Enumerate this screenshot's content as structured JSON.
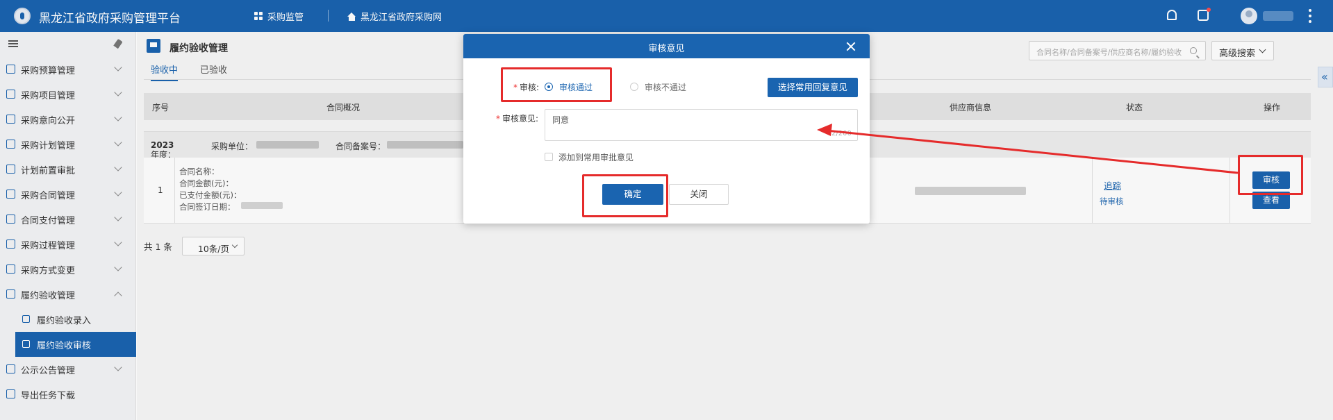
{
  "header": {
    "title": "黑龙江省政府采购管理平台",
    "nav": [
      {
        "label": "采购监管",
        "icon": "grid-icon"
      },
      {
        "label": "黑龙江省政府采购网",
        "icon": "home-icon"
      }
    ],
    "icons": [
      "bell-icon",
      "task-icon",
      "avatar-icon",
      "more-icon"
    ],
    "accent_color": "#1a64b0"
  },
  "sidebar": {
    "items": [
      {
        "label": "采购预算管理"
      },
      {
        "label": "采购项目管理"
      },
      {
        "label": "采购意向公开"
      },
      {
        "label": "采购计划管理"
      },
      {
        "label": "计划前置审批"
      },
      {
        "label": "采购合同管理"
      },
      {
        "label": "合同支付管理"
      },
      {
        "label": "采购过程管理"
      },
      {
        "label": "采购方式变更"
      },
      {
        "label": "履约验收管理"
      }
    ],
    "sub_items": [
      {
        "label": "履约验收录入"
      },
      {
        "label": "履约验收审核"
      }
    ],
    "bottom_items": [
      {
        "label": "公示公告管理"
      },
      {
        "label": "导出任务下载"
      }
    ]
  },
  "main": {
    "page_title": "履约验收管理",
    "tabs": [
      {
        "label": "验收中"
      },
      {
        "label": "已验收"
      }
    ],
    "search_placeholder": "合同名称/合同备案号/供应商名称/履约验收",
    "advanced_search": "高级搜索",
    "table": {
      "headers": [
        "序号",
        "合同概况",
        "供应商信息",
        "状态",
        "操作"
      ],
      "group": {
        "year_label": "年度：",
        "year": "2023",
        "unit_label": "采购单位：",
        "record_label": "合同备案号："
      },
      "row": {
        "index": "1",
        "details": [
          "合同名称：",
          "合同金额(元)：",
          "已支付金额(元)：",
          "合同签订日期："
        ],
        "status_link": "追踪",
        "status": "待审核",
        "actions": [
          "审核",
          "查看"
        ]
      }
    },
    "pager": {
      "total": "共 1 条",
      "page_size": "10条/页"
    }
  },
  "dialog": {
    "title": "审核意见",
    "review_label": "审核:",
    "options": [
      "审核通过",
      "审核不通过"
    ],
    "selected": "审核通过",
    "choose_button": "选择常用回复意见",
    "opinion_label": "审核意见:",
    "opinion_value": "同意",
    "char_count": "2/200",
    "checkbox_label": "添加到常用审批意见",
    "ok_button": "确定",
    "close_button": "关闭"
  },
  "annotation_color": "#e52b2b"
}
